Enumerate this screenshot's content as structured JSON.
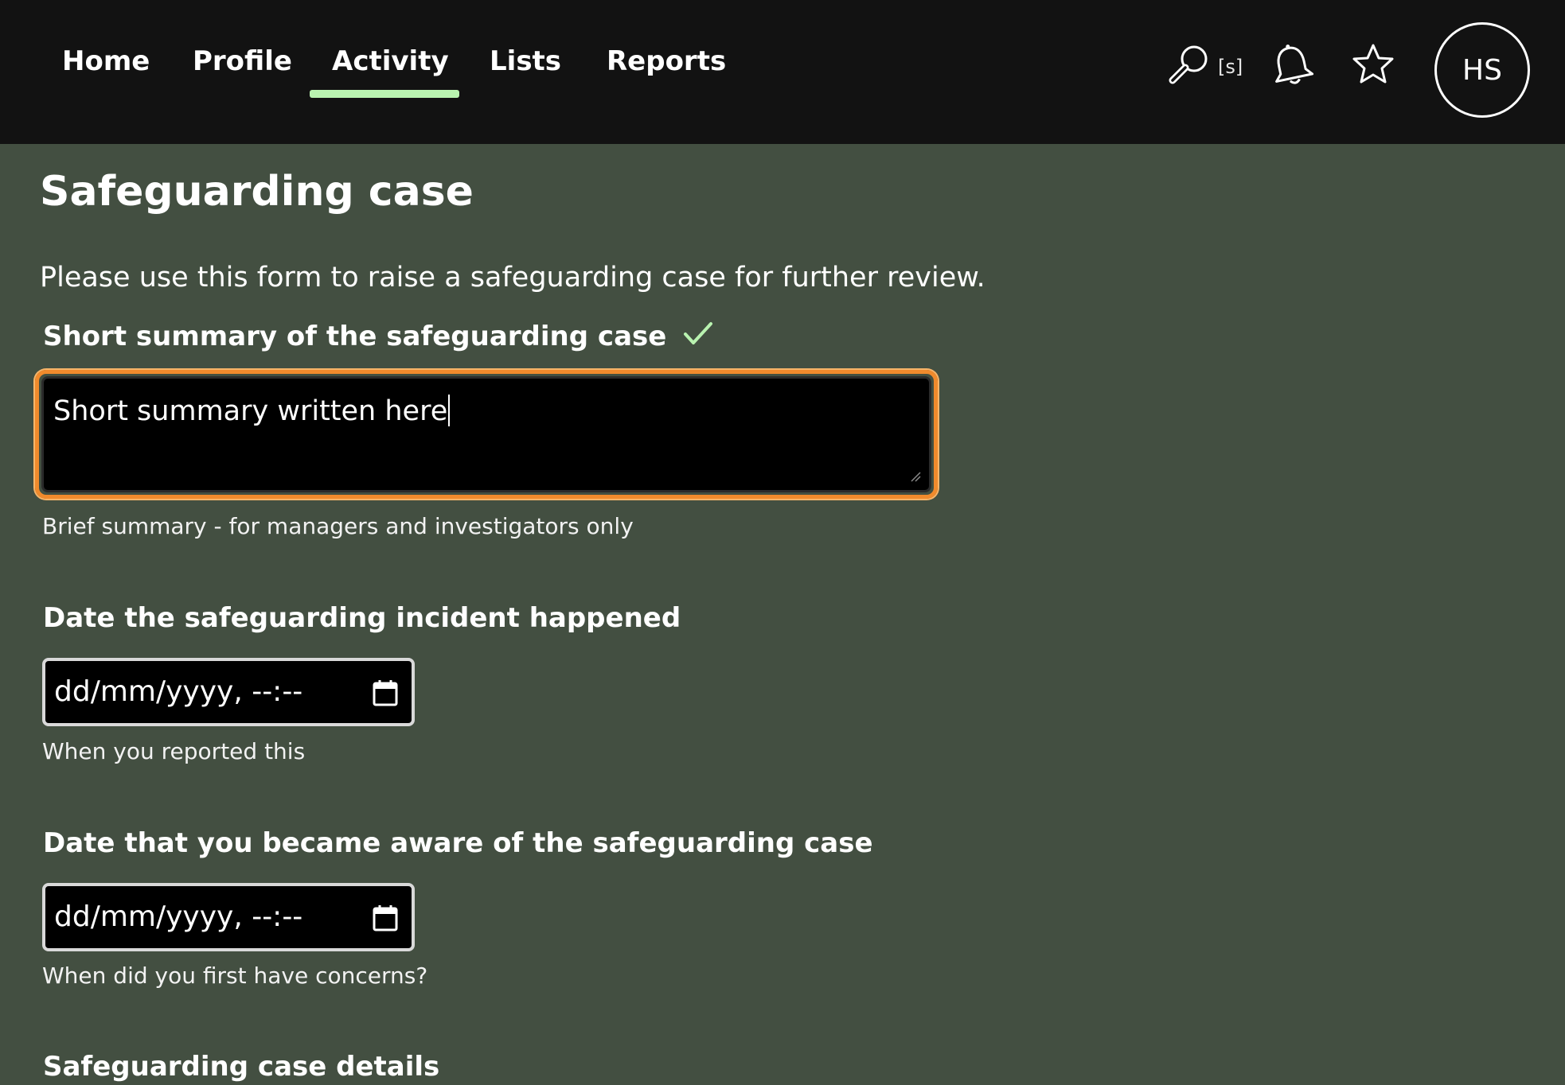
{
  "nav": {
    "tabs": [
      {
        "label": "Home"
      },
      {
        "label": "Profile"
      },
      {
        "label": "Activity",
        "active": true
      },
      {
        "label": "Lists"
      },
      {
        "label": "Reports"
      }
    ],
    "search_shortcut": "[s]",
    "avatar_initials": "HS",
    "icons": [
      "search-icon",
      "bell-icon",
      "star-icon"
    ]
  },
  "page": {
    "title": "Safeguarding case",
    "intro": "Please use this form to raise a safeguarding case for further review."
  },
  "form": {
    "summary": {
      "label": "Short summary of the safeguarding case",
      "value": "Short summary written here",
      "hint": "Brief summary - for managers and investigators only",
      "valid": true
    },
    "incident_date": {
      "label": "Date the safeguarding incident happened",
      "placeholder": "dd/mm/yyyy, --:--",
      "hint": "When you reported this"
    },
    "aware_date": {
      "label": "Date that you became aware of the safeguarding case",
      "placeholder": "dd/mm/yyyy, --:--",
      "hint": "When did you first have concerns?"
    },
    "details": {
      "label": "Safeguarding case details"
    }
  },
  "colors": {
    "nav_background": "#121212",
    "page_background": "#434f41",
    "active_tab_underline": "#b9f3b0",
    "focus_ring": "#f08a2c",
    "valid_check": "#b9f3b0"
  }
}
